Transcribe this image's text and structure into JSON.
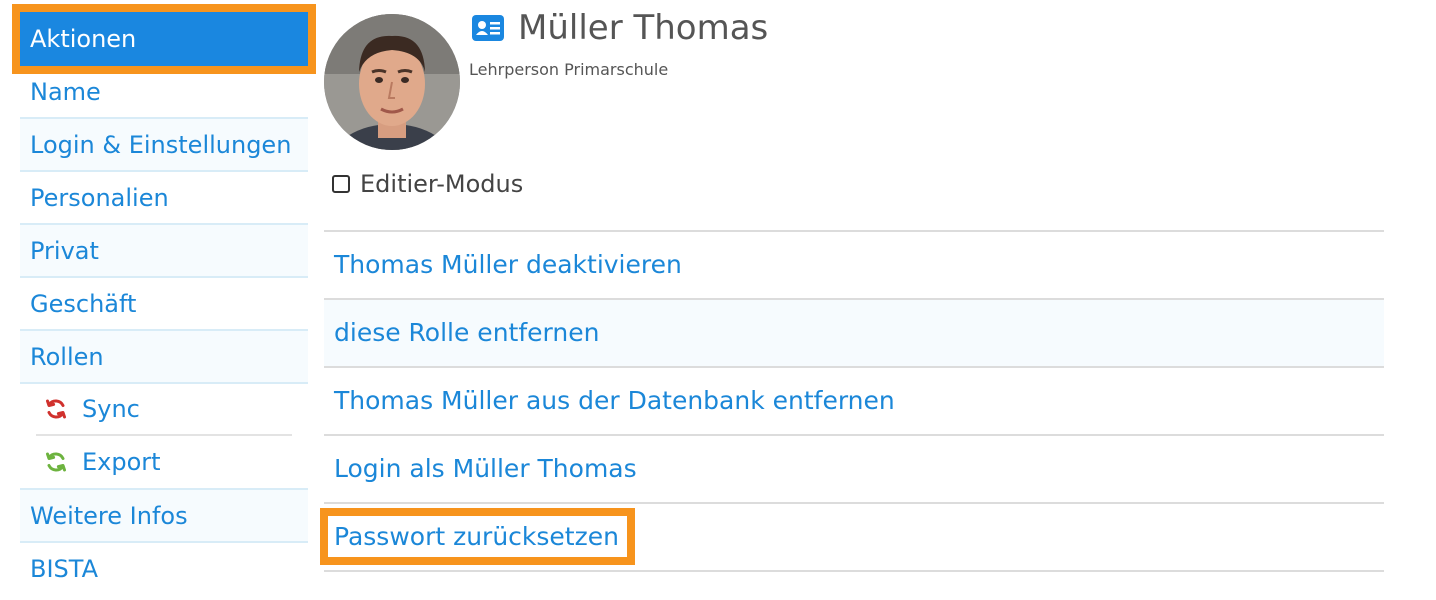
{
  "sidebar": {
    "items": [
      {
        "label": "Aktionen"
      },
      {
        "label": "Name"
      },
      {
        "label": "Login & Einstellungen"
      },
      {
        "label": "Personalien"
      },
      {
        "label": "Privat"
      },
      {
        "label": "Geschäft"
      },
      {
        "label": "Rollen"
      },
      {
        "label": "Weitere Infos"
      },
      {
        "label": "BISTA"
      }
    ],
    "sub_items": [
      {
        "label": "Sync",
        "icon": "refresh-icon",
        "color": "#d0312d"
      },
      {
        "label": "Export",
        "icon": "refresh-icon",
        "color": "#6db33f"
      }
    ]
  },
  "profile": {
    "name": "Müller Thomas",
    "role": "Lehrperson Primarschule",
    "edit_mode_label": "Editier-Modus"
  },
  "actions": [
    {
      "label": "Thomas Müller deaktivieren"
    },
    {
      "label": "diese Rolle entfernen"
    },
    {
      "label": "Thomas Müller aus der Datenbank entfernen"
    },
    {
      "label": "Login als Müller Thomas"
    },
    {
      "label": "Passwort zurücksetzen"
    }
  ],
  "colors": {
    "accent": "#1a87e0",
    "link": "#1b87d8",
    "highlight": "#f7941d"
  }
}
